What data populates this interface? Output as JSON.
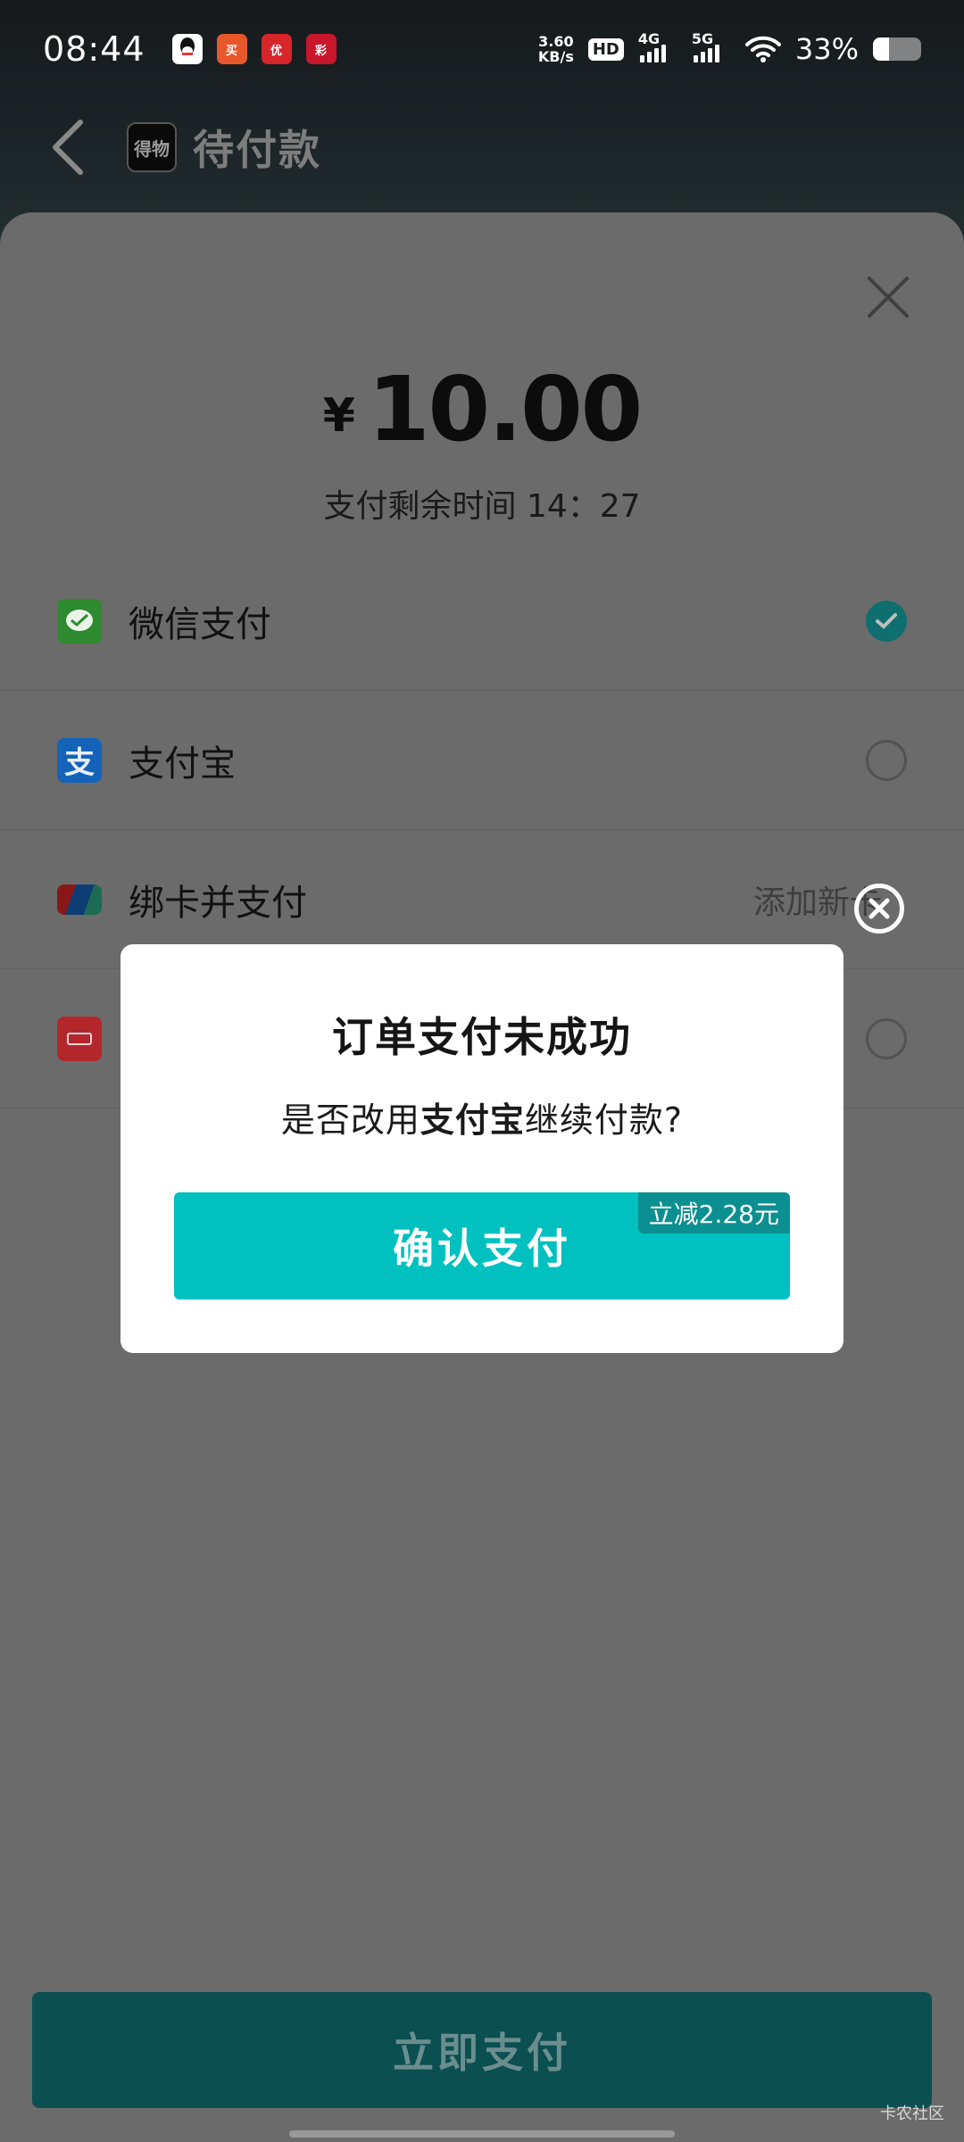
{
  "status_bar": {
    "time": "08:44",
    "app_icons": [
      {
        "name": "qq-icon",
        "text": "",
        "color": "#ffffff"
      },
      {
        "name": "shop-app-icon",
        "text": "买",
        "color": "#e8572a"
      },
      {
        "name": "red-app-icon",
        "text": "优",
        "color": "#d8252a"
      },
      {
        "name": "red-app2-icon",
        "text": "彩",
        "color": "#c8162b"
      }
    ],
    "net_speed_value": "3.60",
    "net_speed_unit": "KB/s",
    "hd_label": "HD",
    "signal_1_label": "4G",
    "signal_2_label": "5G",
    "battery_percent": "33%",
    "battery_level": 0.33
  },
  "header": {
    "title": "待付款",
    "logo_text": "得物"
  },
  "payment": {
    "currency": "¥",
    "amount": "10.00",
    "timer_label": "支付剩余时间 14：27",
    "methods": [
      {
        "label": "微信支付",
        "icon": "wechat-pay-icon",
        "color": "#2e8a2e",
        "selected": true
      },
      {
        "label": "支付宝",
        "icon": "alipay-icon",
        "color": "#1363b8",
        "selected": false
      },
      {
        "label": "绑卡并支付",
        "icon": "unionpay-icon",
        "color": "#8a1717",
        "right_text": "添加新卡"
      },
      {
        "label": "",
        "icon": "cloud-quickpass-icon",
        "color": "#b3262c",
        "selected": false
      }
    ]
  },
  "bottom_button": "立即支付",
  "dialog": {
    "title": "订单支付未成功",
    "message_prefix": "是否改用",
    "message_bold": "支付宝",
    "message_suffix": "继续付款?",
    "confirm_label": "确认支付",
    "discount_badge": "立减2.28元"
  },
  "watermark": "卡农社区"
}
